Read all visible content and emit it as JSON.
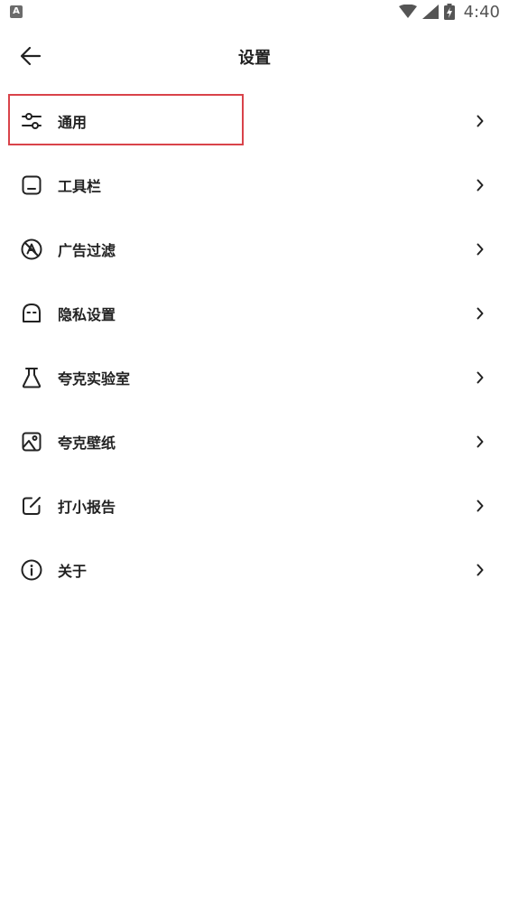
{
  "status_bar": {
    "time": "4:40",
    "app_icon_letter": "A",
    "icons": [
      "wifi-icon",
      "signal-icon",
      "battery-charging-icon"
    ]
  },
  "header": {
    "title": "设置",
    "back_icon": "arrow-left-icon"
  },
  "menu": {
    "items": [
      {
        "label": "通用",
        "icon": "sliders-icon",
        "selected": true
      },
      {
        "label": "工具栏",
        "icon": "toolbar-icon"
      },
      {
        "label": "广告过滤",
        "icon": "ad-block-icon"
      },
      {
        "label": "隐私设置",
        "icon": "privacy-ghost-icon"
      },
      {
        "label": "夸克实验室",
        "icon": "flask-icon"
      },
      {
        "label": "夸克壁纸",
        "icon": "image-icon"
      },
      {
        "label": "打小报告",
        "icon": "edit-report-icon"
      },
      {
        "label": "关于",
        "icon": "info-icon"
      }
    ]
  },
  "colors": {
    "highlight": "#d9434a",
    "text": "#222222",
    "status": "#555555"
  }
}
